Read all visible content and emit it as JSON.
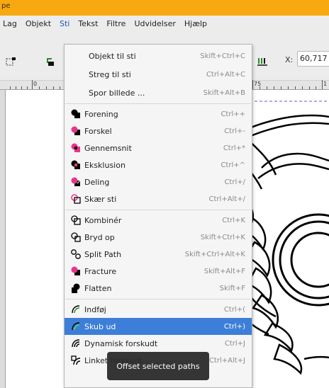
{
  "window": {
    "title_fragment": "pe"
  },
  "menubar": {
    "items": [
      {
        "label": "Lag"
      },
      {
        "label": "Objekt"
      },
      {
        "label": "Sti"
      },
      {
        "label": "Tekst"
      },
      {
        "label": "Filtre"
      },
      {
        "label": "Udvidelser"
      },
      {
        "label": "Hjælp"
      }
    ]
  },
  "toolbar": {
    "x_label": "X:",
    "x_value": "60,717"
  },
  "ruler": {
    "labels": [
      "0",
      "75",
      "1"
    ]
  },
  "path_menu": {
    "items": [
      {
        "label": "Objekt til sti",
        "shortcut": "Skift+Ctrl+C",
        "icon": "none"
      },
      {
        "label": "Streg til sti",
        "shortcut": "Ctrl+Alt+C",
        "icon": "none"
      },
      {
        "label": "Spor billede ...",
        "shortcut": "Skift+Alt+B",
        "icon": "none"
      },
      {
        "label": "Forening",
        "shortcut": "Ctrl++",
        "icon": "union-icon"
      },
      {
        "label": "Forskel",
        "shortcut": "Ctrl+-",
        "icon": "difference-icon"
      },
      {
        "label": "Gennemsnit",
        "shortcut": "Ctrl+*",
        "icon": "intersection-icon"
      },
      {
        "label": "Eksklusion",
        "shortcut": "Ctrl+^",
        "icon": "exclusion-icon"
      },
      {
        "label": "Deling",
        "shortcut": "Ctrl+/",
        "icon": "division-icon"
      },
      {
        "label": "Skær sti",
        "shortcut": "Ctrl+Alt+/",
        "icon": "cut-path-icon"
      },
      {
        "label": "Kombinér",
        "shortcut": "Ctrl+K",
        "icon": "combine-icon"
      },
      {
        "label": "Bryd op",
        "shortcut": "Skift+Ctrl+K",
        "icon": "break-apart-icon"
      },
      {
        "label": "Split Path",
        "shortcut": "Skift+Ctrl+Alt+K",
        "icon": "split-path-icon"
      },
      {
        "label": "Fracture",
        "shortcut": "Skift+Alt+F",
        "icon": "fracture-icon"
      },
      {
        "label": "Flatten",
        "shortcut": "Skift+F",
        "icon": "flatten-icon"
      },
      {
        "label": "Indføj",
        "shortcut": "Ctrl+(",
        "icon": "inset-icon"
      },
      {
        "label": "Skub ud",
        "shortcut": "Ctrl+)",
        "icon": "outset-icon"
      },
      {
        "label": "Dynamisk forskudt",
        "shortcut": "Ctrl+J",
        "icon": "dynamic-offset-icon"
      },
      {
        "label": "Linket forskudt",
        "shortcut": "Ctrl+Alt+J",
        "icon": "linked-offset-icon"
      }
    ]
  },
  "tooltip": {
    "text": "Offset selected paths"
  },
  "colors": {
    "titlebar": "#f7a90f",
    "highlight": "#3d7fd8",
    "accent_pink": "#e8358a",
    "menu_active": "#1c54b7"
  }
}
